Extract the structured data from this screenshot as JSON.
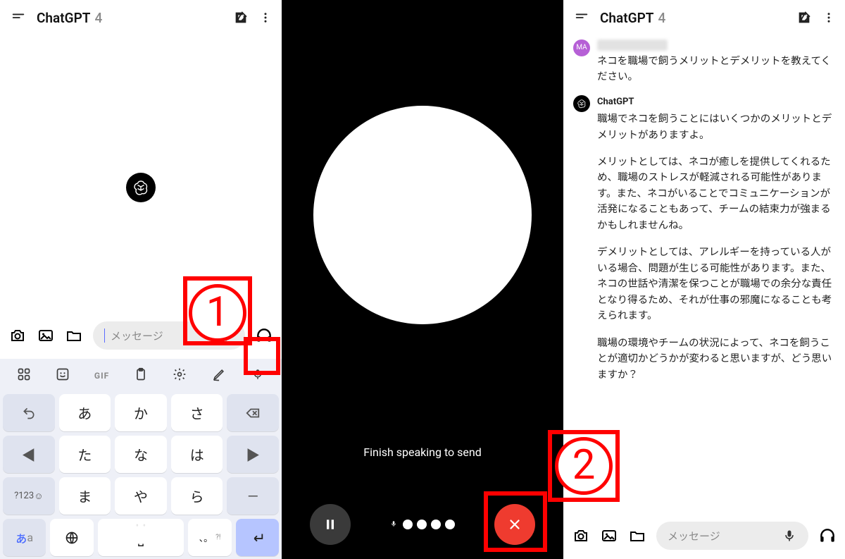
{
  "header": {
    "title": "ChatGPT",
    "version": "4"
  },
  "input": {
    "placeholder": "メッセージ"
  },
  "keyboard": {
    "toolbar": [
      "grid",
      "sticker",
      "GIF",
      "clipboard",
      "settings",
      "pen",
      "mic"
    ],
    "rows": [
      [
        "↩",
        "あ",
        "か",
        "さ",
        "⌫"
      ],
      [
        "◀",
        "た",
        "な",
        "は",
        "▶"
      ],
      [
        "?123 ☺",
        "ま",
        "や",
        "ら",
        "—"
      ],
      [
        "あa",
        "⊕",
        "␣",
        "、。?!",
        "↵"
      ]
    ],
    "mode_jp": "あ",
    "mode_en": "a",
    "numkey": "?123",
    "punct": "、。"
  },
  "voice": {
    "caption": "Finish speaking to send"
  },
  "annotations": {
    "one": "1",
    "two": "2"
  },
  "chat": {
    "user_avatar": "MA",
    "user_text": "ネコを職場で飼うメリットとデメリットを教えてください。",
    "assistant_name": "ChatGPT",
    "assistant_paragraphs": [
      "職場でネコを飼うことにはいくつかのメリットとデメリットがありますよ。",
      "メリットとしては、ネコが癒しを提供してくれるため、職場のストレスが軽減される可能性があります。また、ネコがいることでコミュニケーションが活発になることもあって、チームの結束力が強まるかもしれませんね。",
      "デメリットとしては、アレルギーを持っている人がいる場合、問題が生じる可能性があります。また、ネコの世話や清潔を保つことが職場での余分な責任となり得るため、それが仕事の邪魔になることも考えられます。",
      "職場の環境やチームの状況によって、ネコを飼うことが適切かどうかが変わると思いますが、どう思いますか？"
    ]
  }
}
